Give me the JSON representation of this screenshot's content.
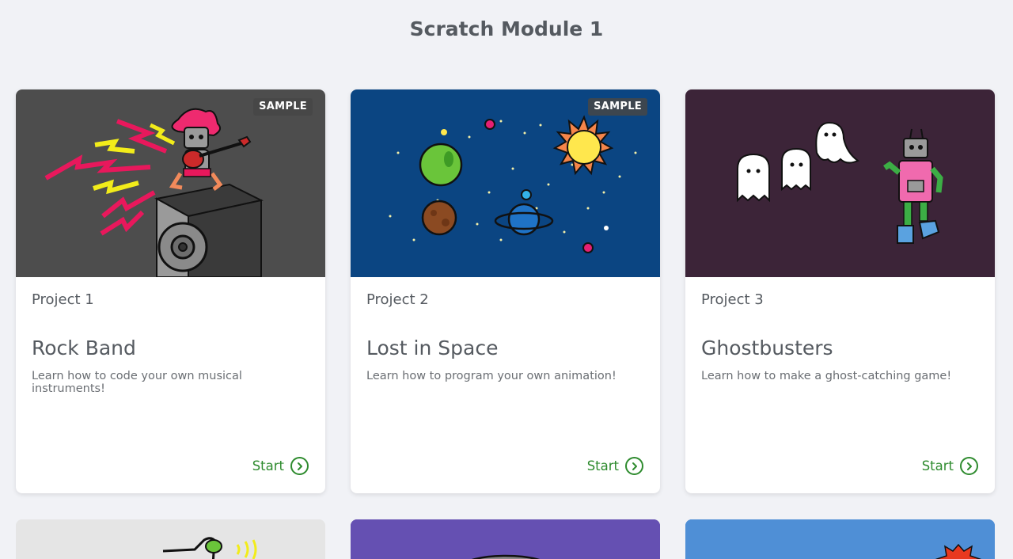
{
  "page": {
    "title": "Scratch Module 1"
  },
  "colors": {
    "background": "#f1f2f6",
    "accent_green": "#2e8b2e",
    "thumb_rock_band": "#4d4d4d",
    "thumb_lost_in_space": "#0b4582",
    "thumb_ghostbusters": "#3c2438",
    "thumb_row2_1": "#e5e5e5",
    "thumb_row2_2": "#6550b2",
    "thumb_row2_3": "#4f8fd6"
  },
  "cards": [
    {
      "badge": "SAMPLE",
      "project_number": "Project 1",
      "title": "Rock Band",
      "description": "Learn how to code your own musical instruments!",
      "start_label": "Start",
      "start_icon": "chevron-right-circle-icon",
      "thumbnail": "rock-band-robot-guitar-illustration"
    },
    {
      "badge": "SAMPLE",
      "project_number": "Project 2",
      "title": "Lost in Space",
      "description": "Learn how to program your own animation!",
      "start_label": "Start",
      "start_icon": "chevron-right-circle-icon",
      "thumbnail": "space-planets-illustration"
    },
    {
      "badge": "",
      "project_number": "Project 3",
      "title": "Ghostbusters",
      "description": "Learn how to make a ghost-catching game!",
      "start_label": "Start",
      "start_icon": "chevron-right-circle-icon",
      "thumbnail": "ghosts-and-robot-illustration"
    }
  ]
}
